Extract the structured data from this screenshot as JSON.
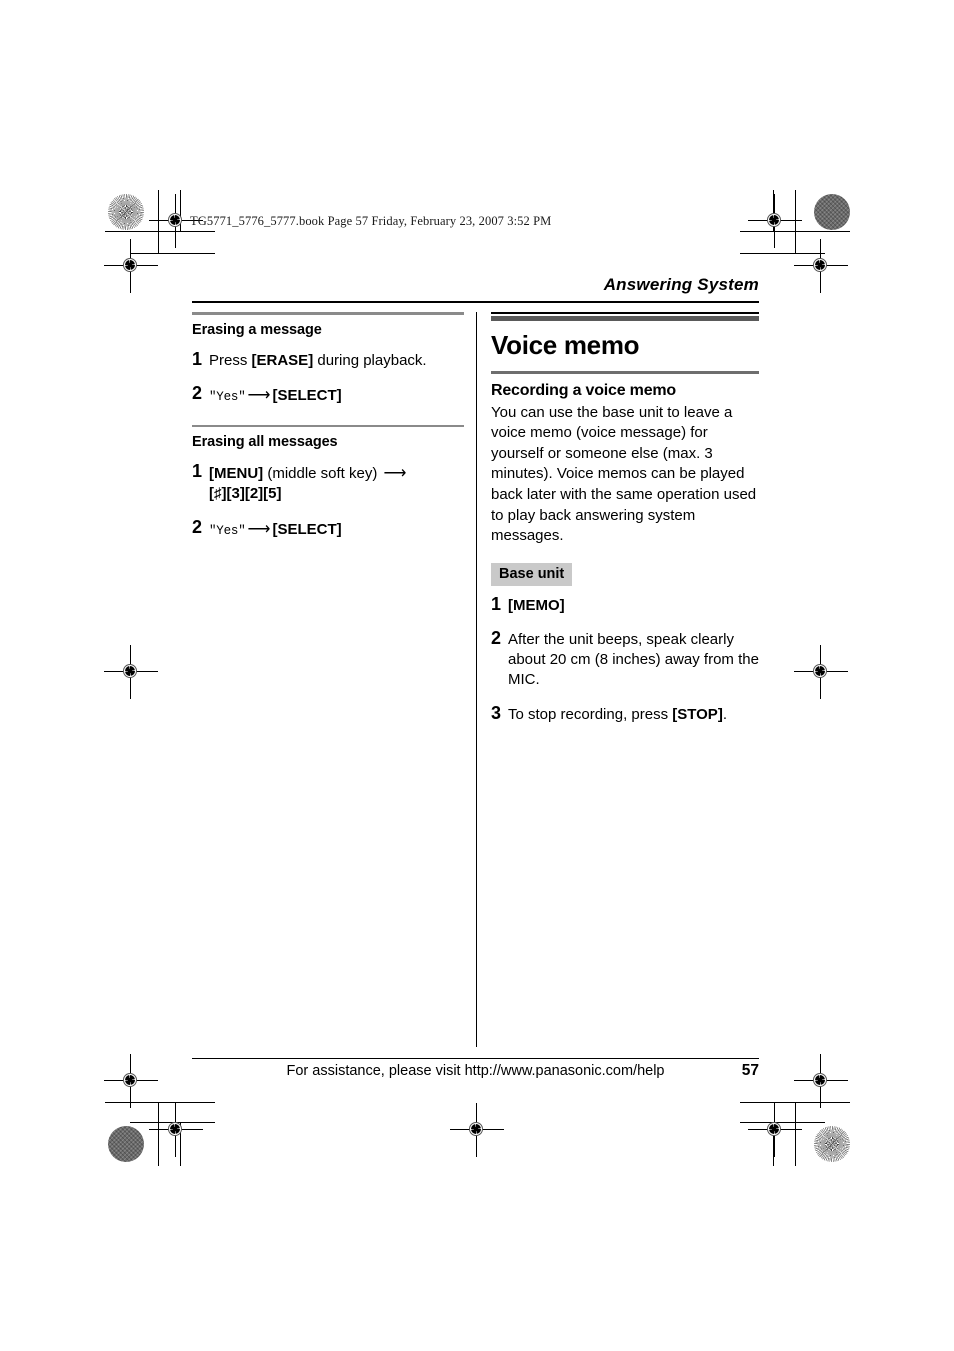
{
  "book_header": "TG5771_5776_5777.book  Page 57  Friday, February 23, 2007  3:52 PM",
  "running_head": "Answering System",
  "left_column": {
    "sections": [
      {
        "heading": "Erasing a message",
        "steps": [
          {
            "number": "1",
            "parts": [
              {
                "type": "text",
                "text": "Press "
              },
              {
                "type": "key",
                "text": "[ERASE]"
              },
              {
                "type": "text",
                "text": " during playback."
              }
            ]
          },
          {
            "number": "2",
            "parts": [
              {
                "type": "mono",
                "text": "\"Yes\""
              },
              {
                "type": "arrow",
                "text": "⟶"
              },
              {
                "type": "key",
                "text": "[SELECT]"
              }
            ]
          }
        ]
      },
      {
        "heading": "Erasing all messages",
        "steps": [
          {
            "number": "1",
            "parts": [
              {
                "type": "key",
                "text": "[MENU]"
              },
              {
                "type": "text",
                "text": " (middle soft key) "
              },
              {
                "type": "arrow",
                "text": "⟶"
              },
              {
                "type": "break",
                "text": ""
              },
              {
                "type": "key",
                "text": "[♯][3][2][5]"
              }
            ]
          },
          {
            "number": "2",
            "parts": [
              {
                "type": "mono",
                "text": "\"Yes\""
              },
              {
                "type": "arrow",
                "text": "⟶"
              },
              {
                "type": "key",
                "text": "[SELECT]"
              }
            ]
          }
        ]
      }
    ]
  },
  "right_column": {
    "chapter_title": "Voice memo",
    "section_heading": "Recording a voice memo",
    "body_paragraph": "You can use the base unit to leave a voice memo (voice message) for yourself or someone else (max. 3 minutes). Voice memos can be played back later with the same operation used to play back answering system messages.",
    "badge": "Base unit",
    "steps": [
      {
        "number": "1",
        "parts": [
          {
            "type": "key",
            "text": "[MEMO]"
          }
        ]
      },
      {
        "number": "2",
        "parts": [
          {
            "type": "text",
            "text": "After the unit beeps, speak clearly about 20 cm (8 inches) away from the MIC."
          }
        ]
      },
      {
        "number": "3",
        "parts": [
          {
            "type": "text",
            "text": "To stop recording, press "
          },
          {
            "type": "key",
            "text": "[STOP]"
          },
          {
            "type": "text",
            "text": "."
          }
        ]
      }
    ]
  },
  "footer": {
    "assistance_text": "For assistance, please visit http://www.panasonic.com/help",
    "page_number": "57"
  },
  "colors": {
    "rule_gray": "#8a8a8a",
    "badge_bg": "#c9c9c9",
    "chapter_bar": "#5a5a5a",
    "text": "#000000"
  }
}
